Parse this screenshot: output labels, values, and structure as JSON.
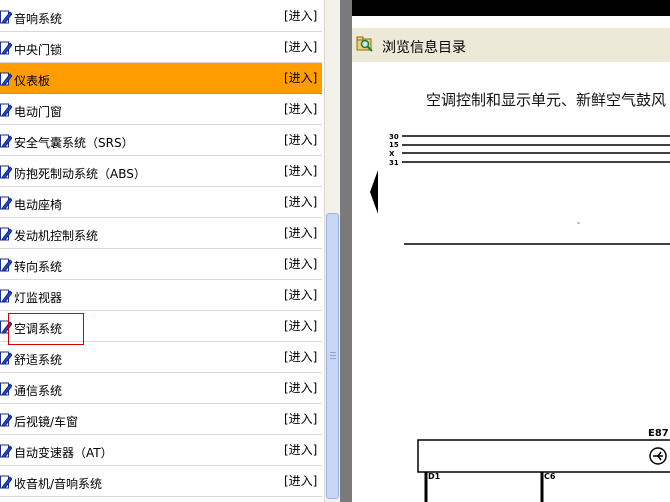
{
  "list": {
    "enter_label": "[进入]",
    "items": [
      {
        "label": "音响系统"
      },
      {
        "label": "中央门锁"
      },
      {
        "label": "仪表板",
        "active": true
      },
      {
        "label": "电动门窗"
      },
      {
        "label": "安全气囊系统（SRS）"
      },
      {
        "label": "防抱死制动系统（ABS）"
      },
      {
        "label": "电动座椅"
      },
      {
        "label": "发动机控制系统"
      },
      {
        "label": "转向系统"
      },
      {
        "label": "灯监视器"
      },
      {
        "label": "空调系统",
        "highlighted": true
      },
      {
        "label": "舒适系统"
      },
      {
        "label": "通信系统"
      },
      {
        "label": "后视镜/车窗"
      },
      {
        "label": "自动变速器（AT）"
      },
      {
        "label": "收音机/音响系统"
      }
    ]
  },
  "toolbar": {
    "toc_label": "浏览信息目录",
    "toc_icon": "folder-magnifier-icon"
  },
  "document": {
    "title": "空调控制和显示单元、新鲜空气鼓风",
    "wire_labels": [
      "30",
      "15",
      "X",
      "31"
    ],
    "component_label": "E87",
    "pin_labels": [
      "D1",
      "C6"
    ]
  },
  "colors": {
    "active_row": "#ff9c00",
    "highlight_border": "#d20000",
    "toolbar_bg": "#ece9d8",
    "scroll_thumb": "#c8d6f5"
  }
}
